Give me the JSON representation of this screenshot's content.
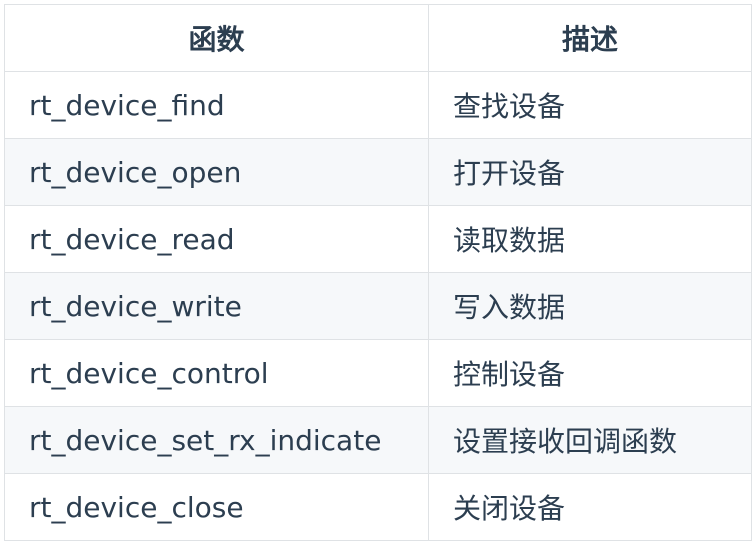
{
  "table": {
    "headers": [
      "函数",
      "描述"
    ],
    "rows": [
      {
        "func": "rt_device_find",
        "desc": "查找设备"
      },
      {
        "func": "rt_device_open",
        "desc": "打开设备"
      },
      {
        "func": "rt_device_read",
        "desc": "读取数据"
      },
      {
        "func": "rt_device_write",
        "desc": "写入数据"
      },
      {
        "func": "rt_device_control",
        "desc": "控制设备"
      },
      {
        "func": "rt_device_set_rx_indicate",
        "desc": "设置接收回调函数"
      },
      {
        "func": "rt_device_close",
        "desc": "关闭设备"
      }
    ]
  }
}
